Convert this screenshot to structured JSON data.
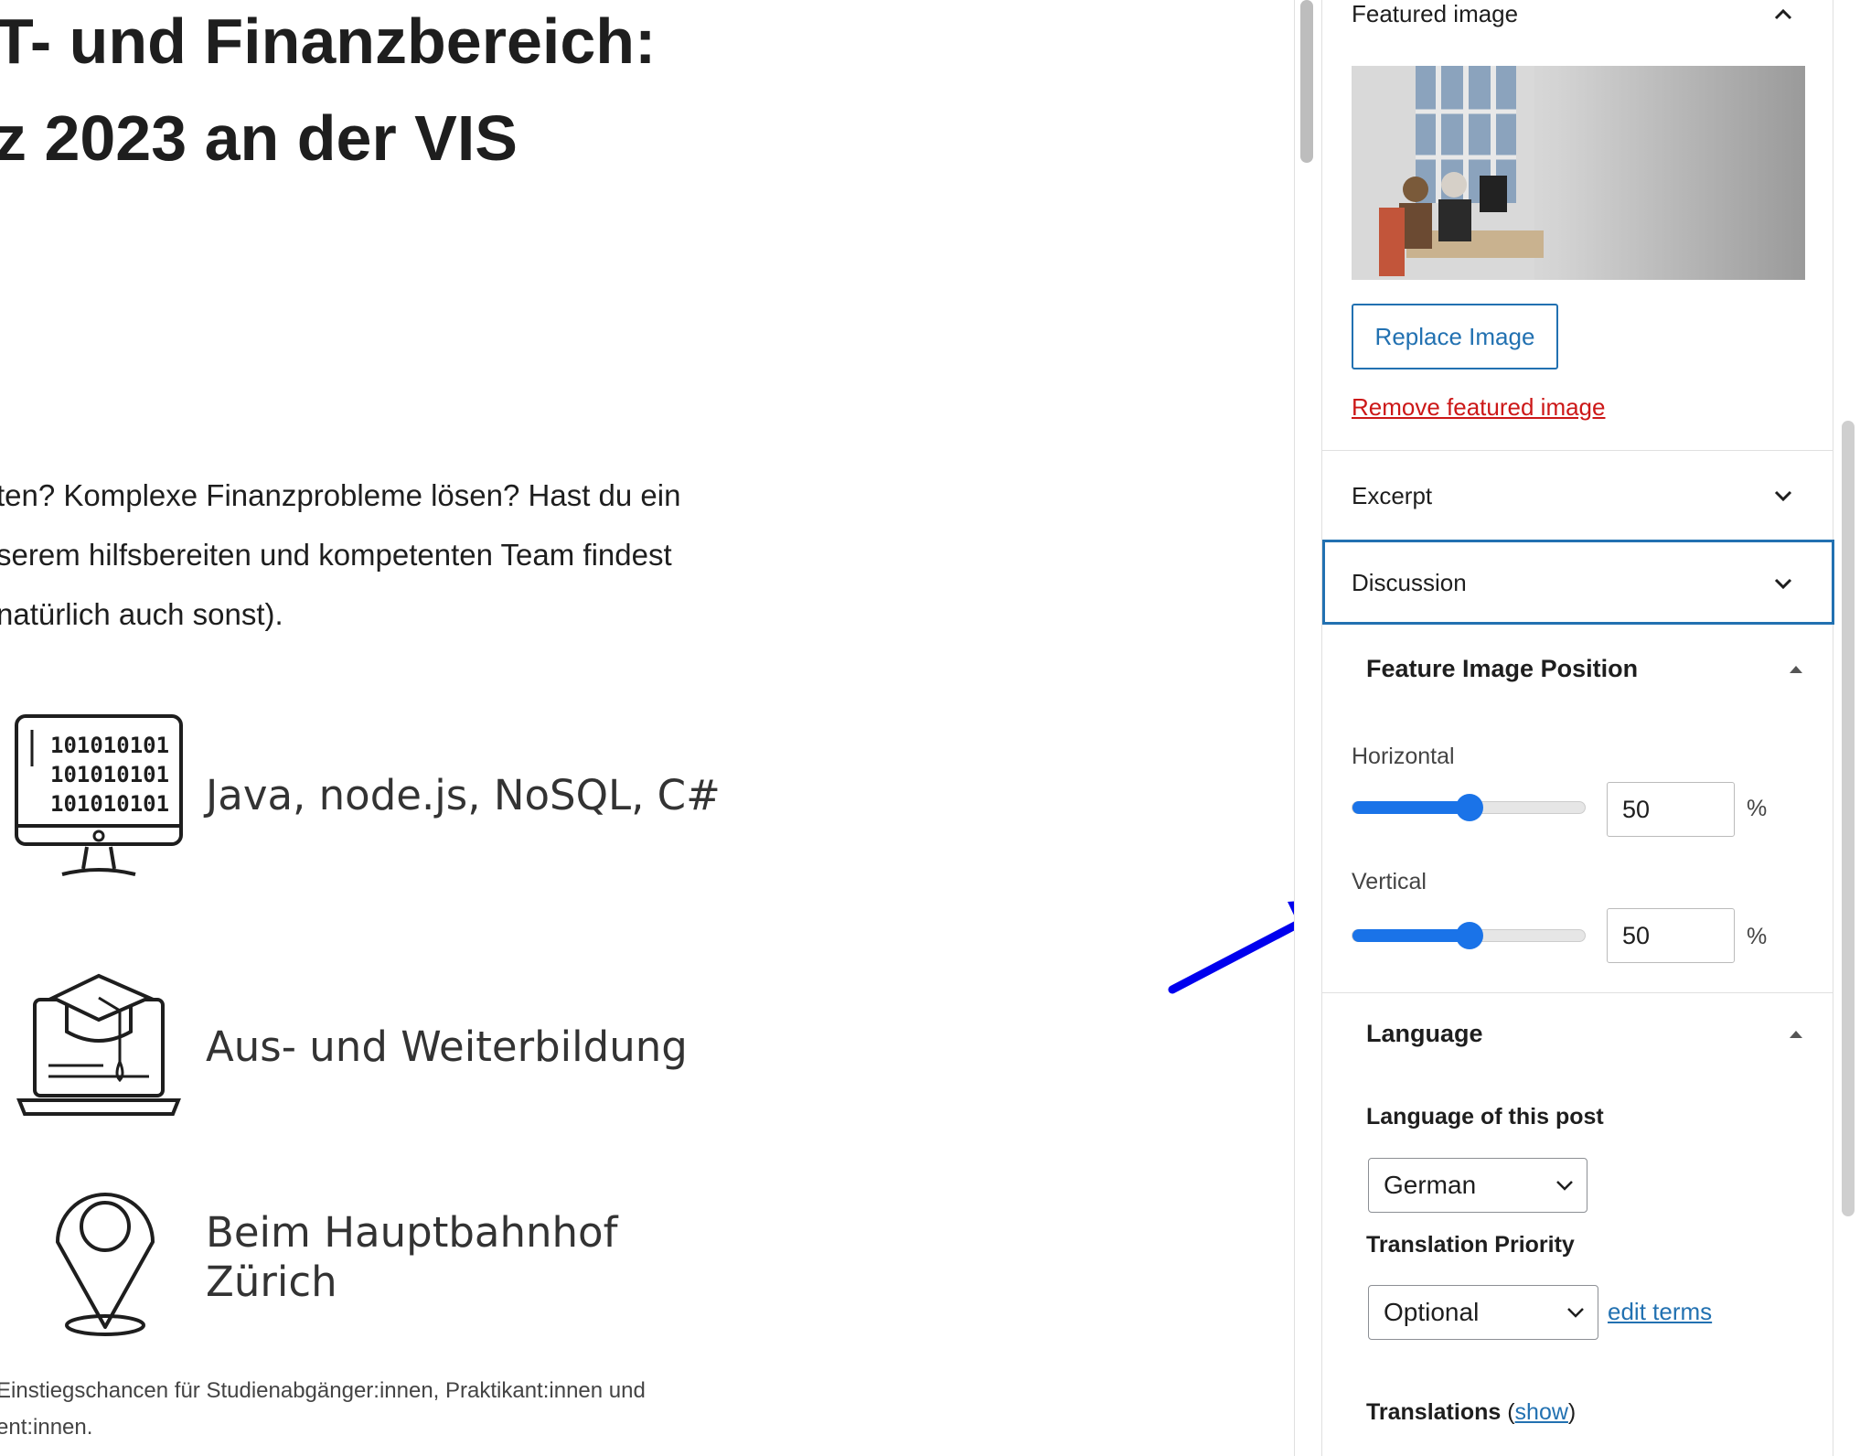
{
  "editor": {
    "title_lines": [
      "T- und Finanzbereich:",
      "z 2023 an der VIS"
    ],
    "paragraph_lines": [
      "ten? Komplexe Finanzprobleme lösen? Hast du ein",
      "serem hilfsbereiten und kompetenten Team findest",
      "natürlich auch sonst)."
    ],
    "features": [
      {
        "icon": "computer-binary-icon",
        "text": "Java, node.js, NoSQL, C#",
        "binary": "101010101"
      },
      {
        "icon": "laptop-graduation-cap-icon",
        "text": "Aus- und  Weiterbildung"
      },
      {
        "icon": "map-pin-icon",
        "text_line1": "Beim Hauptbahnhof",
        "text_line2": "Zürich"
      }
    ],
    "caption_lines": [
      "Einstiegschancen für Studienabgänger:innen, Praktikant:innen und",
      "ent:innen."
    ]
  },
  "sidebar": {
    "featured_image": {
      "title": "Featured image",
      "replace_label": "Replace Image",
      "remove_label": "Remove featured image"
    },
    "excerpt": {
      "title": "Excerpt"
    },
    "discussion": {
      "title": "Discussion"
    },
    "feature_image_position": {
      "title": "Feature Image Position",
      "horizontal_label": "Horizontal",
      "horizontal_value": "50",
      "vertical_label": "Vertical",
      "vertical_value": "50",
      "unit": "%"
    },
    "language": {
      "title": "Language",
      "post_language_label": "Language of this post",
      "post_language_value": "German",
      "priority_label": "Translation Priority",
      "priority_value": "Optional",
      "edit_terms": "edit terms",
      "translations_label": "Translations",
      "translations_open": "(",
      "translations_show": "show",
      "translations_close": ")"
    }
  },
  "colors": {
    "accent": "#2271b1",
    "slider": "#1a73e8",
    "danger": "#cc1818",
    "annotation_arrow": "#0000ee"
  }
}
